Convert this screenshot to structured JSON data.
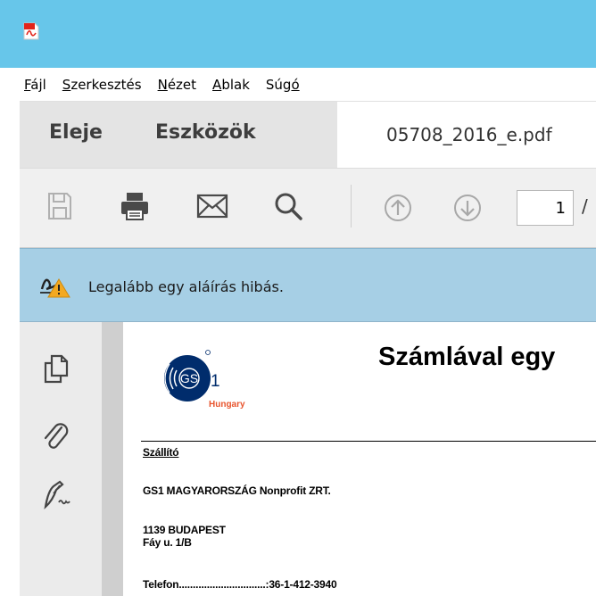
{
  "menu": {
    "items": [
      {
        "mnemonic": "F",
        "rest": "ájl"
      },
      {
        "mnemonic": "S",
        "rest": "zerkesztés"
      },
      {
        "mnemonic": "N",
        "rest": "ézet"
      },
      {
        "mnemonic": "A",
        "rest": "blak"
      },
      {
        "lead": "Súg",
        "mnemonic": "ó"
      }
    ]
  },
  "tabs": {
    "home": "Eleje",
    "tools": "Eszközök",
    "document": "05708_2016_e.pdf"
  },
  "toolbar": {
    "icons": [
      "save-icon",
      "print-icon",
      "email-icon",
      "search-icon",
      "previous-page-icon",
      "next-page-icon"
    ],
    "page_number": "1",
    "page_separator": "/"
  },
  "signature_banner": {
    "message": "Legalább egy aláírás hibás.",
    "icon": "signature-warning-icon",
    "warning_color": "#f3a921"
  },
  "side_panel": {
    "icons": [
      "page-thumbnails-icon",
      "attachments-icon",
      "signatures-icon"
    ]
  },
  "document": {
    "title": "Számlával egy",
    "logo": {
      "mark": "GS",
      "mark_suffix": "1",
      "subtitle": "Hungary",
      "brand_color": "#002c6c",
      "accent_color": "#e8542d"
    },
    "supplier_heading": "Szállító",
    "company": "GS1 MAGYARORSZÁG Nonprofit ZRT.",
    "address_line1": "1139 BUDAPEST",
    "address_line2": "Fáy u. 1/B",
    "phone": "Telefon...............................:36-1-412-3940"
  },
  "colors": {
    "titlebar": "#67c6ea",
    "banner": "#a6cfe5"
  }
}
